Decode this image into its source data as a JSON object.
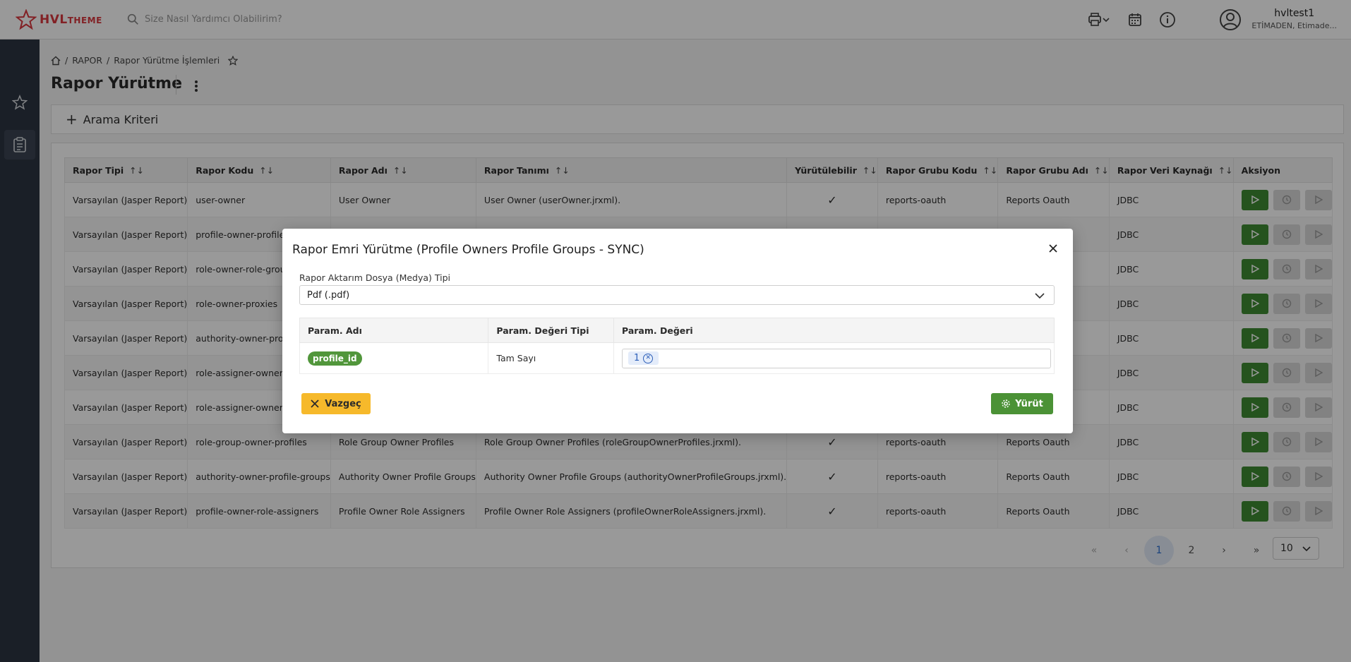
{
  "brand": {
    "logo_main": "HVL",
    "logo_sub": "THEME",
    "accent": "#d9373e"
  },
  "topbar": {
    "search_placeholder": "Size Nasıl Yardımcı Olabilirim?",
    "icons": [
      "print-icon",
      "calendar-icon",
      "info-icon"
    ],
    "user": {
      "name": "hvltest1",
      "org": "ETİMADEN, Etimade..."
    }
  },
  "sidebar": {
    "items": [
      "favorites-star-icon",
      "reports-clipboard-icon"
    ]
  },
  "breadcrumb": {
    "items": [
      "RAPOR",
      "Rapor Yürütme İşlemleri"
    ]
  },
  "page": {
    "title": "Rapor Yürütme"
  },
  "filter": {
    "label": "Arama Kriteri"
  },
  "table": {
    "columns": [
      "Rapor Tipi",
      "Rapor Kodu",
      "Rapor Adı",
      "Rapor Tanımı",
      "Yürütülebilir",
      "Rapor Grubu Kodu",
      "Rapor Grubu Adı",
      "Rapor Veri Kaynağı",
      "Aksiyon"
    ],
    "sort_symbol": "↑↓",
    "rows": [
      {
        "type": "Varsayılan (Jasper Report)",
        "code": "user-owner",
        "name": "User Owner",
        "desc": "User Owner (userOwner.jrxml).",
        "exec": "✓",
        "group_code": "reports-oauth",
        "group_name": "Reports Oauth",
        "source": "JDBC"
      },
      {
        "type": "Varsayılan (Jasper Report)",
        "code": "profile-owner-profile-g",
        "name": "",
        "desc": "",
        "exec": "",
        "group_code": "",
        "group_name": "",
        "source": "JDBC"
      },
      {
        "type": "Varsayılan (Jasper Report)",
        "code": "role-owner-role-groups",
        "name": "",
        "desc": "",
        "exec": "",
        "group_code": "",
        "group_name": "",
        "source": "JDBC"
      },
      {
        "type": "Varsayılan (Jasper Report)",
        "code": "role-owner-proxies",
        "name": "",
        "desc": "",
        "exec": "",
        "group_code": "",
        "group_name": "",
        "source": "JDBC"
      },
      {
        "type": "Varsayılan (Jasper Report)",
        "code": "authority-owner-proxie",
        "name": "",
        "desc": "",
        "exec": "",
        "group_code": "",
        "group_name": "",
        "source": "JDBC"
      },
      {
        "type": "Varsayılan (Jasper Report)",
        "code": "role-assigner-owner-pr",
        "name": "",
        "desc": "",
        "exec": "",
        "group_code": "",
        "group_name": "",
        "source": "JDBC"
      },
      {
        "type": "Varsayılan (Jasper Report)",
        "code": "role-assigner-owner-ro",
        "name": "",
        "desc": "",
        "exec": "",
        "group_code": "",
        "group_name": "",
        "source": "JDBC"
      },
      {
        "type": "Varsayılan (Jasper Report)",
        "code": "role-group-owner-profiles",
        "name": "Role Group Owner Profiles",
        "desc": "Role Group Owner Profiles (roleGroupOwnerProfiles.jrxml).",
        "exec": "✓",
        "group_code": "reports-oauth",
        "group_name": "Reports Oauth",
        "source": "JDBC"
      },
      {
        "type": "Varsayılan (Jasper Report)",
        "code": "authority-owner-profile-groups",
        "name": "Authority Owner Profile Groups",
        "desc": "Authority Owner Profile Groups (authorityOwnerProfileGroups.jrxml).",
        "exec": "✓",
        "group_code": "reports-oauth",
        "group_name": "Reports Oauth",
        "source": "JDBC"
      },
      {
        "type": "Varsayılan (Jasper Report)",
        "code": "profile-owner-role-assigners",
        "name": "Profile Owner Role Assigners",
        "desc": "Profile Owner Role Assigners (profileOwnerRoleAssigners.jrxml).",
        "exec": "✓",
        "group_code": "reports-oauth",
        "group_name": "Reports Oauth",
        "source": "JDBC"
      }
    ]
  },
  "pagination": {
    "first": "«",
    "prev": "‹",
    "pages": [
      "1",
      "2"
    ],
    "current": "1",
    "next": "›",
    "last": "»",
    "page_size": "10"
  },
  "modal": {
    "title": "Rapor Emri Yürütme (Profile Owners Profile Groups - SYNC)",
    "media_label": "Rapor Aktarım Dosya (Medya) Tipi",
    "media_value": "Pdf (.pdf)",
    "param_columns": [
      "Param. Adı",
      "Param. Değeri Tipi",
      "Param. Değeri"
    ],
    "params": [
      {
        "name": "profile_id",
        "type": "Tam Sayı",
        "value": "1"
      }
    ],
    "cancel_label": "Vazgeç",
    "run_label": "Yürüt",
    "cancel_color": "#f6b92b",
    "run_color": "#4b9236"
  }
}
